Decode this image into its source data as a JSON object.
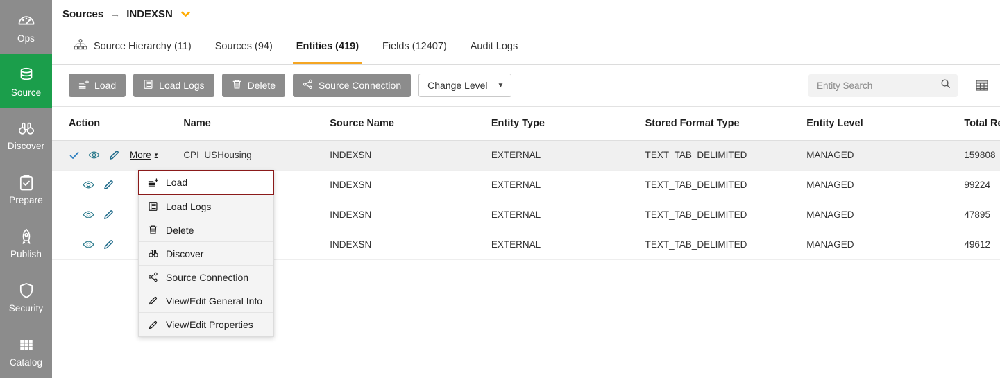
{
  "sidebar": {
    "items": [
      {
        "label": "Ops",
        "icon": "gauge-icon",
        "active": false
      },
      {
        "label": "Source",
        "icon": "database-icon",
        "active": true
      },
      {
        "label": "Discover",
        "icon": "binoculars-icon",
        "active": false
      },
      {
        "label": "Prepare",
        "icon": "clipboard-check-icon",
        "active": false
      },
      {
        "label": "Publish",
        "icon": "rocket-icon",
        "active": false
      },
      {
        "label": "Security",
        "icon": "shield-icon",
        "active": false
      },
      {
        "label": "Catalog",
        "icon": "grid-icon",
        "active": false
      }
    ],
    "active_color": "#1b9e4b",
    "background": "#8c8c8c"
  },
  "breadcrumb": {
    "root": "Sources",
    "separator": "→",
    "current": "INDEXSN",
    "caret": "❯",
    "caret_color": "#FFAB00"
  },
  "tabs": [
    {
      "label": "Source Hierarchy (11)",
      "icon": "hierarchy-icon",
      "active": false
    },
    {
      "label": "Sources (94)",
      "icon": "",
      "active": false
    },
    {
      "label": "Entities (419)",
      "icon": "",
      "active": true
    },
    {
      "label": "Fields (12407)",
      "icon": "",
      "active": false
    },
    {
      "label": "Audit Logs",
      "icon": "",
      "active": false
    }
  ],
  "toolbar": {
    "buttons": [
      {
        "label": "Load",
        "icon": "load-icon"
      },
      {
        "label": "Load Logs",
        "icon": "logs-icon"
      },
      {
        "label": "Delete",
        "icon": "trash-icon"
      },
      {
        "label": "Source Connection",
        "icon": "connection-icon"
      }
    ],
    "select": {
      "label": "Change Level",
      "caret": "▼"
    },
    "search": {
      "placeholder": "Entity Search",
      "value": "",
      "icon": "search-icon"
    },
    "grid_toggle_icon": "table-view-icon"
  },
  "table": {
    "columns": [
      "Action",
      "Name",
      "Source Name",
      "Entity Type",
      "Stored Format Type",
      "Entity Level",
      "Total Record"
    ],
    "rows": [
      {
        "selected": true,
        "check": true,
        "more_label": "More",
        "more_caret": "▾",
        "name": "CPI_USHousing",
        "source_name": "INDEXSN",
        "entity_type": "EXTERNAL",
        "stored_format_type": "TEXT_TAB_DELIMITED",
        "entity_level": "MANAGED",
        "total_record": "159808"
      },
      {
        "selected": false,
        "check": false,
        "more_label": "",
        "more_caret": "",
        "name": "",
        "source_name": "INDEXSN",
        "entity_type": "EXTERNAL",
        "stored_format_type": "TEXT_TAB_DELIMITED",
        "entity_level": "MANAGED",
        "total_record": "99224"
      },
      {
        "selected": false,
        "check": false,
        "more_label": "",
        "more_caret": "",
        "name": "",
        "source_name": "INDEXSN",
        "entity_type": "EXTERNAL",
        "stored_format_type": "TEXT_TAB_DELIMITED",
        "entity_level": "MANAGED",
        "total_record": "47895"
      },
      {
        "selected": false,
        "check": false,
        "more_label": "",
        "more_caret": "",
        "name": "",
        "source_name": "INDEXSN",
        "entity_type": "EXTERNAL",
        "stored_format_type": "TEXT_TAB_DELIMITED",
        "entity_level": "MANAGED",
        "total_record": "49612"
      }
    ]
  },
  "context_menu": {
    "highlight_color": "#8B1A1A",
    "items": [
      {
        "label": "Load",
        "icon": "load-icon",
        "highlighted": true
      },
      {
        "label": "Load Logs",
        "icon": "logs-icon",
        "highlighted": false
      },
      {
        "label": "Delete",
        "icon": "trash-icon",
        "highlighted": false
      },
      {
        "label": "Discover",
        "icon": "binoculars-icon",
        "highlighted": false
      },
      {
        "label": "Source Connection",
        "icon": "connection-icon",
        "highlighted": false
      },
      {
        "label": "View/Edit General Info",
        "icon": "pencil-icon",
        "highlighted": false
      },
      {
        "label": "View/Edit Properties",
        "icon": "pencil-icon",
        "highlighted": false
      }
    ]
  }
}
